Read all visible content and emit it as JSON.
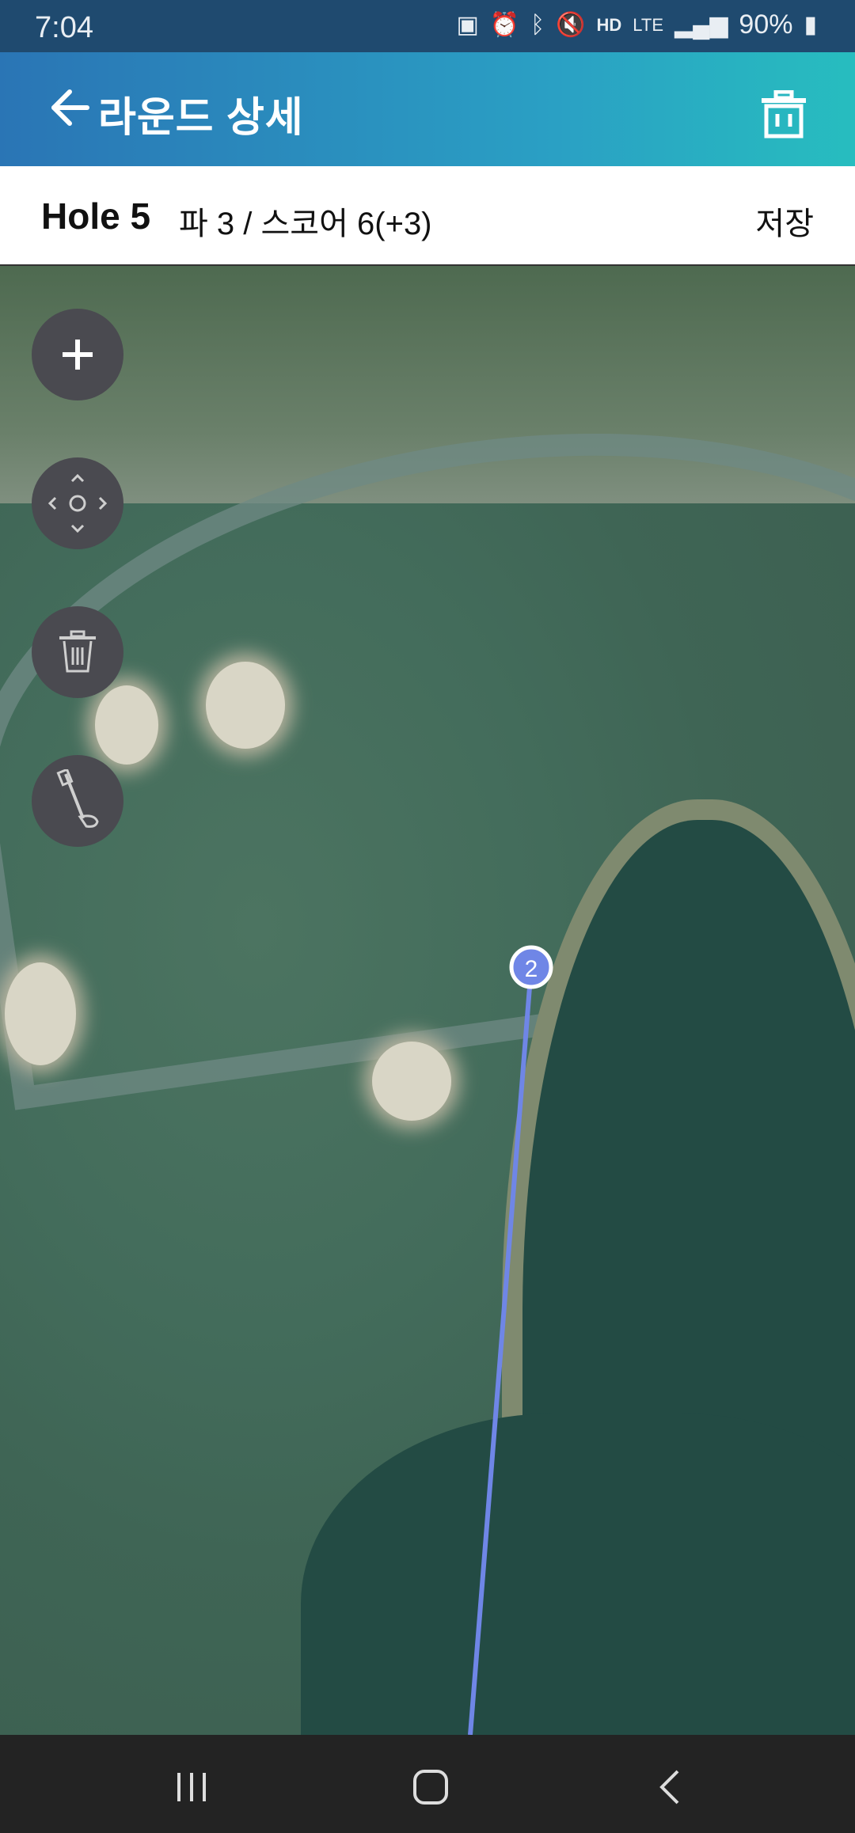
{
  "status_bar": {
    "time": "7:04",
    "battery": "90%",
    "icons": [
      "notification-icon",
      "alarm-icon",
      "bluetooth-icon",
      "mute-icon",
      "hd-voice-icon",
      "lte-icon",
      "signal-icon",
      "battery-icon"
    ]
  },
  "app_bar": {
    "title": "라운드 상세",
    "back_icon": "arrow-left-icon",
    "delete_icon": "trash-icon"
  },
  "hole_bar": {
    "hole": "Hole 5",
    "info": "파 3 / 스코어 6(+3)",
    "save_label": "저장"
  },
  "map": {
    "controls": [
      "plus-icon",
      "move-icon",
      "trash-icon",
      "golf-club-icon"
    ],
    "shot_marker": "2",
    "line_color": "#6f86e6"
  },
  "nav_bar": {
    "icons": [
      "recent-apps-icon",
      "home-icon",
      "back-icon"
    ]
  }
}
